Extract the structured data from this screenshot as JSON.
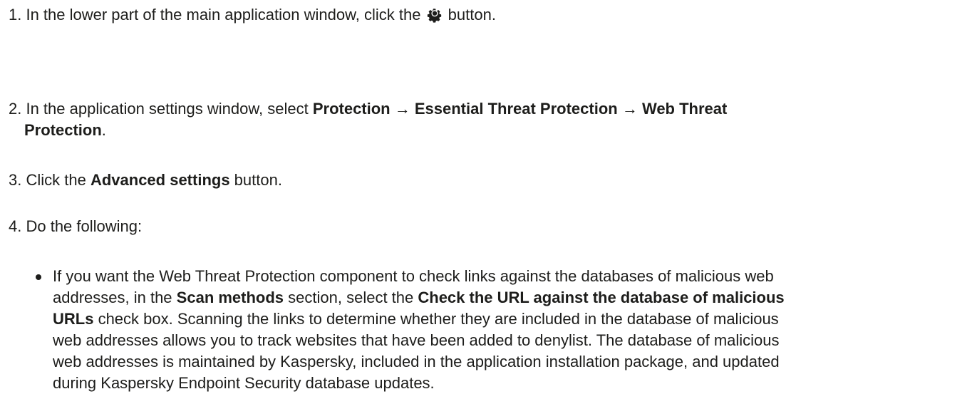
{
  "steps": [
    {
      "num": "1.",
      "text_before": " In the lower part of the main application window, click the ",
      "icon": "gear-icon",
      "text_after": " button."
    },
    {
      "num": "2.",
      "text_before": " In the application settings window, select ",
      "b1": "Protection",
      "arrow1": " → ",
      "b2": "Essential Threat Protection",
      "arrow2": " → ",
      "b3": "Web Threat",
      "b3_cont": "Protection",
      "text_after": "."
    },
    {
      "num": "3.",
      "text_before": " Click the ",
      "b1": "Advanced settings",
      "text_after": " button."
    },
    {
      "num": "4.",
      "text": " Do the following:"
    }
  ],
  "bullet": {
    "line1": "If you want the Web Threat Protection component to check links against the databases of malicious web",
    "line2_before": "addresses, in the ",
    "line2_b1": "Scan methods",
    "line2_mid": " section, select the ",
    "line2_b2": "Check the URL against the database of malicious",
    "line3_b": "URLs",
    "line3_after": " check box. Scanning the links to determine whether they are included in the database of malicious",
    "line4": "web addresses allows you to track websites that have been added to denylist. The database of malicious",
    "line5": "web addresses is maintained by Kaspersky, included in the application installation package, and updated",
    "line6": "during Kaspersky Endpoint Security database updates."
  },
  "colors": {
    "text": "#1d1d1b",
    "background": "#ffffff"
  }
}
